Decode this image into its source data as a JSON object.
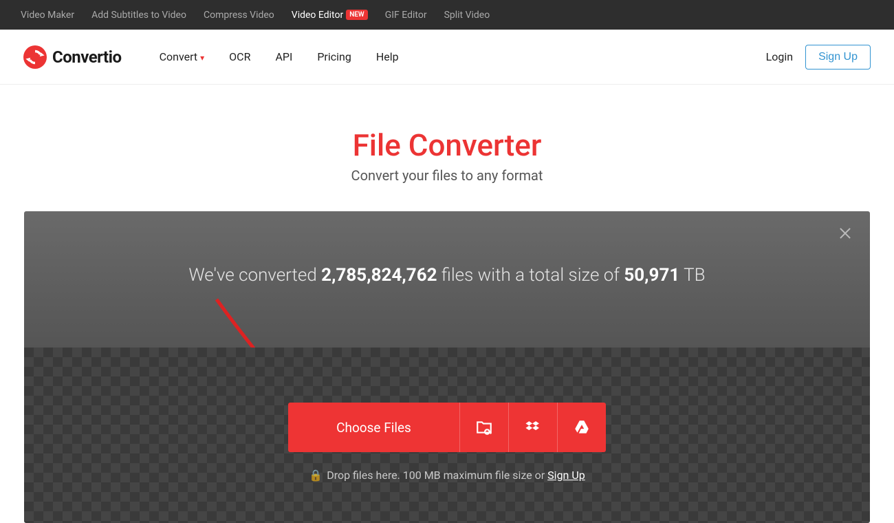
{
  "topbar": {
    "items": [
      {
        "label": "Video Maker"
      },
      {
        "label": "Add Subtitles to Video"
      },
      {
        "label": "Compress Video"
      },
      {
        "label": "Video Editor",
        "badge": "NEW",
        "active": true
      },
      {
        "label": "GIF Editor"
      },
      {
        "label": "Split Video"
      }
    ]
  },
  "brand": {
    "name": "Convertio"
  },
  "nav": {
    "convert": "Convert",
    "ocr": "OCR",
    "api": "API",
    "pricing": "Pricing",
    "help": "Help",
    "login": "Login",
    "signup": "Sign Up"
  },
  "hero": {
    "title": "File Converter",
    "subtitle": "Convert your files to any format"
  },
  "stats": {
    "prefix": "We've converted ",
    "files": "2,785,824,762",
    "mid": " files with a total size of ",
    "size": "50,971",
    "unit": " TB"
  },
  "upload": {
    "choose": "Choose Files",
    "drop_prefix": "Drop files here. 100 MB maximum file size or ",
    "signup": "Sign Up"
  }
}
